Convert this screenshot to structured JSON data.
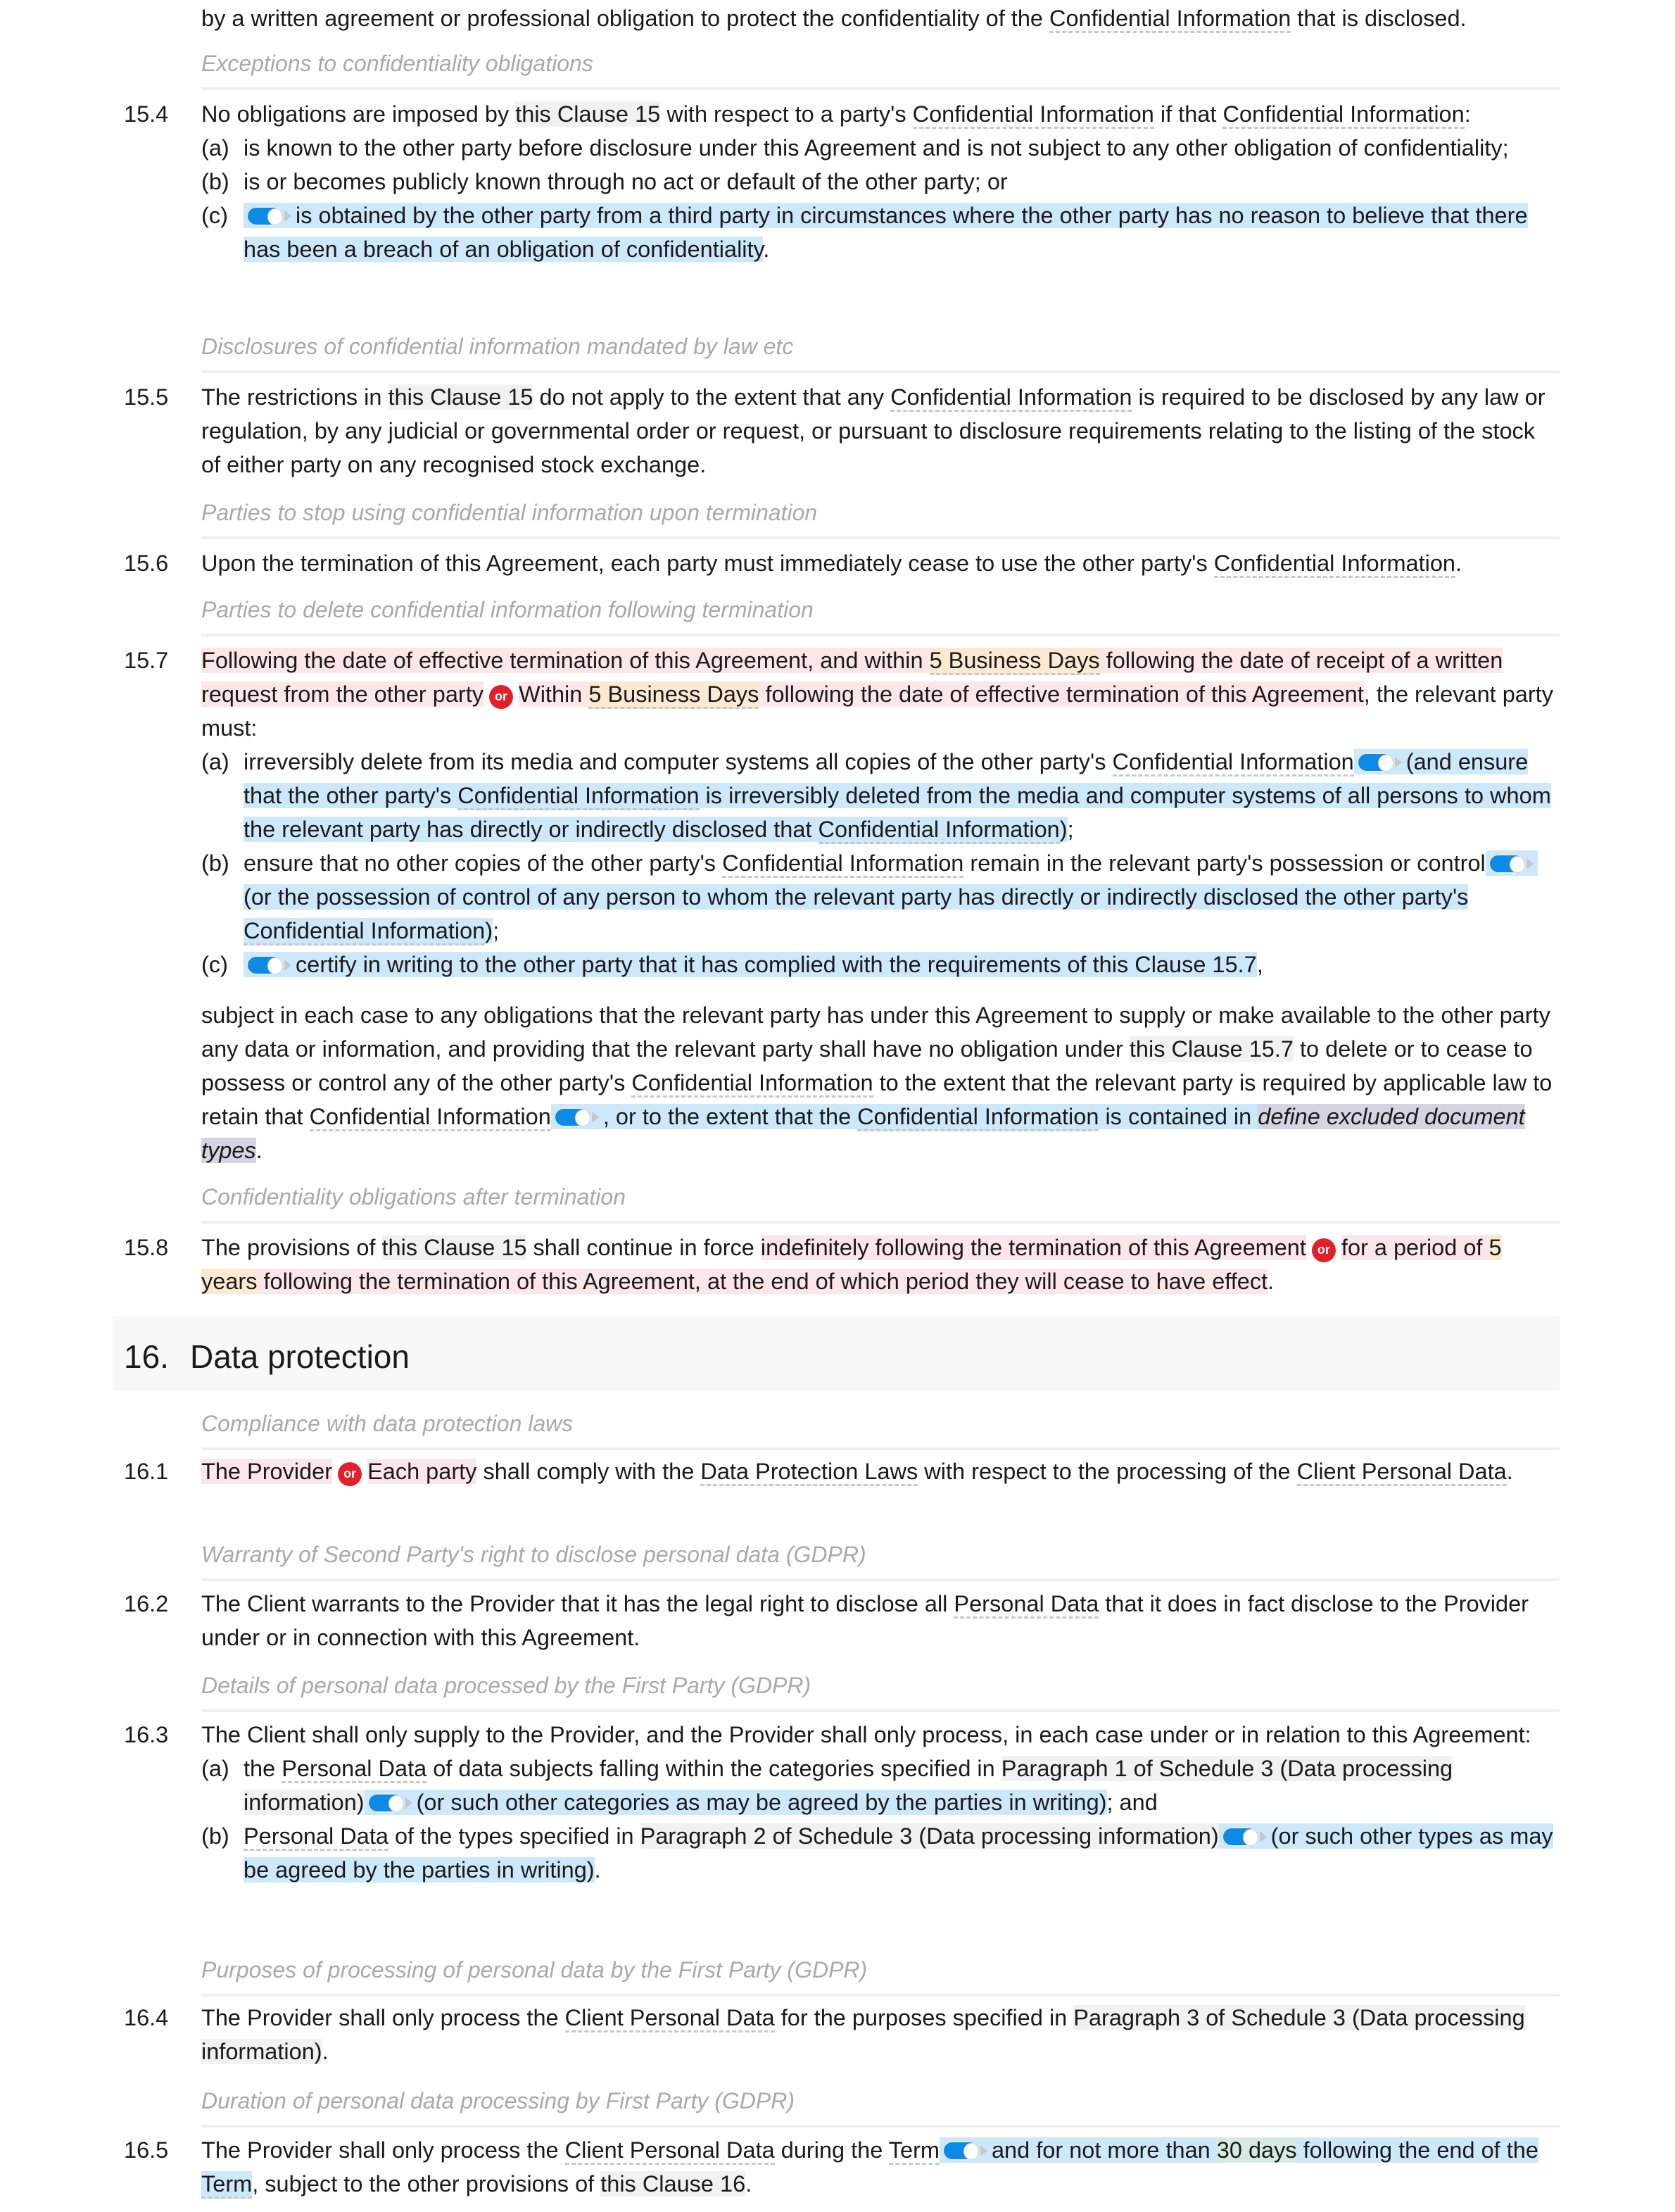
{
  "document": {
    "intro_tail": [
      {
        "t": "by a written agreement or professional obligation to protect the confidentiality of the "
      },
      {
        "t": "Confidential Information",
        "c": "def"
      },
      {
        "t": " that is disclosed."
      }
    ],
    "captions": {
      "c154": "Exceptions to confidentiality obligations",
      "c155": "Disclosures of confidential information mandated by law etc",
      "c156": "Parties to stop using confidential information upon termination",
      "c157": "Parties to delete confidential information following termination",
      "c158": "Confidentiality obligations after termination",
      "c161": "Compliance with data protection laws",
      "c162": "Warranty of Second Party's right to disclose personal data (GDPR)",
      "c163": "Details of personal data processed by the First Party (GDPR)",
      "c164": "Purposes of processing of personal data by the First Party (GDPR)",
      "c165": "Duration of personal data processing by First Party (GDPR)"
    },
    "heading16": {
      "number": "16.",
      "title": "Data protection"
    },
    "clauses": {
      "c154": {
        "number": "15.4",
        "text": [
          {
            "t": "No obligations are imposed by "
          },
          {
            "t": "this Clause 15",
            "c": "ref"
          },
          {
            "t": " with respect to a party's "
          },
          {
            "t": "Confidential Information",
            "c": "def"
          },
          {
            "t": " if that "
          },
          {
            "t": "Confidential Information",
            "c": "def"
          },
          {
            "t": ":"
          }
        ],
        "items": [
          {
            "label": "(a)",
            "text": [
              {
                "t": "is known to the other party before disclosure under this Agreement and is not subject to any other obligation of confidentiality;"
              }
            ]
          },
          {
            "label": "(b)",
            "text": [
              {
                "t": "is or becomes publicly known through no act or default of the other party; or"
              }
            ]
          },
          {
            "label": "(c)",
            "text": [
              {
                "toggle": true,
                "c": "blue"
              },
              {
                "t": "is obtained by the other party from a third party in circumstances where the other party has no reason to believe that there has been a breach of an obligation of confidentiality",
                "c": "blue"
              },
              {
                "t": "."
              }
            ]
          }
        ]
      },
      "c155": {
        "number": "15.5",
        "text": [
          {
            "t": "The restrictions in "
          },
          {
            "t": "this Clause 15",
            "c": "ref"
          },
          {
            "t": " do not apply to the extent that any "
          },
          {
            "t": "Confidential Information",
            "c": "def"
          },
          {
            "t": " is required to be disclosed by any law or regulation, by any judicial or governmental order or request, or pursuant to disclosure requirements relating to the listing of the stock of either party on any recognised stock exchange."
          }
        ]
      },
      "c156": {
        "number": "15.6",
        "text": [
          {
            "t": "Upon the termination of this Agreement, each party must immediately cease to use the other party's "
          },
          {
            "t": "Confidential Information",
            "c": "def"
          },
          {
            "t": "."
          }
        ]
      },
      "c157": {
        "number": "15.7",
        "text": [
          {
            "t": "Following the date of effective termination of this Agreement, and within ",
            "c": "opt"
          },
          {
            "t": "5 Business Days",
            "c": "var def"
          },
          {
            "t": " following the date of receipt of a written request from the other party",
            "c": "opt"
          },
          {
            "or": "or"
          },
          {
            "t": "Within ",
            "c": "opt"
          },
          {
            "t": "5 Business Days",
            "c": "var def"
          },
          {
            "t": " following the date of effective termination of this Agreement",
            "c": "opt"
          },
          {
            "t": ", the relevant party must:"
          }
        ],
        "items": [
          {
            "label": "(a)",
            "text": [
              {
                "t": "irreversibly delete from its media and computer systems all copies of the other party's "
              },
              {
                "t": "Confidential Information",
                "c": "def"
              },
              {
                "toggle": true,
                "c": "blue"
              },
              {
                "t": "(and ensure that the other party's ",
                "c": "blue"
              },
              {
                "t": "Confidential Information",
                "c": "blue def"
              },
              {
                "t": " is irreversibly deleted from the media and computer systems of all persons to whom the relevant party has directly or indirectly disclosed that ",
                "c": "blue"
              },
              {
                "t": "Confidential Information",
                "c": "blue def"
              },
              {
                "t": ")",
                "c": "blue"
              },
              {
                "t": ";"
              }
            ]
          },
          {
            "label": "(b)",
            "text": [
              {
                "t": "ensure that no other copies of the other party's "
              },
              {
                "t": "Confidential Information",
                "c": "def"
              },
              {
                "t": " remain in the relevant party's possession or control"
              },
              {
                "toggle": true,
                "c": "blue"
              },
              {
                "t": "(or the possession of control of any person to whom the relevant party has directly or indirectly disclosed the other party's ",
                "c": "blue"
              },
              {
                "t": "Confidential Information",
                "c": "blue def"
              },
              {
                "t": ")",
                "c": "blue"
              },
              {
                "t": ";"
              }
            ]
          },
          {
            "label": "(c)",
            "text": [
              {
                "toggle": true,
                "c": "blue"
              },
              {
                "t": "certify in writing to the other party that it has complied with the requirements of ",
                "c": "blue"
              },
              {
                "t": "this Clause 15.7",
                "c": "blue ref"
              },
              {
                "t": ","
              }
            ]
          }
        ],
        "tail": [
          {
            "t": "subject in each case to any obligations that the relevant party has under this Agreement to supply or make available to the other party any data or information, and providing that the relevant party shall have no obligation under "
          },
          {
            "t": "this Clause 15.7",
            "c": "ref"
          },
          {
            "t": " to delete or to cease to possess or control any of the other party's "
          },
          {
            "t": "Confidential Information",
            "c": "def"
          },
          {
            "t": " to the extent that the relevant party is required by applicable law to retain that "
          },
          {
            "t": "Confidential Information",
            "c": "def"
          },
          {
            "toggle": true,
            "c": "blue"
          },
          {
            "t": ", or to the extent that the ",
            "c": "blue"
          },
          {
            "t": "Confidential Information",
            "c": "blue def"
          },
          {
            "t": " is contained in ",
            "c": "blue"
          },
          {
            "t": "define excluded document types",
            "c": "ph"
          },
          {
            "t": "."
          }
        ]
      },
      "c158": {
        "number": "15.8",
        "text": [
          {
            "t": "The provisions of "
          },
          {
            "t": "this Clause 15",
            "c": "ref"
          },
          {
            "t": " shall continue in force "
          },
          {
            "t": "indefinitely following the termination of this Agreement",
            "c": "opt"
          },
          {
            "or": "or"
          },
          {
            "t": "for a period of ",
            "c": "opt"
          },
          {
            "t": "5 years",
            "c": "var"
          },
          {
            "t": " following the termination of this Agreement, at the end of which period they will cease to have effect",
            "c": "opt"
          },
          {
            "t": "."
          }
        ]
      },
      "c161": {
        "number": "16.1",
        "text": [
          {
            "t": "The Provider",
            "c": "opt"
          },
          {
            "or": "or"
          },
          {
            "t": "Each party",
            "c": "opt"
          },
          {
            "t": " shall comply with the "
          },
          {
            "t": "Data Protection Laws",
            "c": "def"
          },
          {
            "t": " with respect to the processing of the "
          },
          {
            "t": "Client Personal Data",
            "c": "def"
          },
          {
            "t": "."
          }
        ]
      },
      "c162": {
        "number": "16.2",
        "text": [
          {
            "t": "The Client warrants to the Provider that it has the legal right to disclose all "
          },
          {
            "t": "Personal Data",
            "c": "def"
          },
          {
            "t": " that it does in fact disclose to the Provider under or in connection with this Agreement."
          }
        ]
      },
      "c163": {
        "number": "16.3",
        "text": [
          {
            "t": "The Client shall only supply to the Provider, and the Provider shall only process, in each case under or in relation to this Agreement:"
          }
        ],
        "items": [
          {
            "label": "(a)",
            "text": [
              {
                "t": "the "
              },
              {
                "t": "Personal Data",
                "c": "def"
              },
              {
                "t": " of data subjects falling within the categories specified in "
              },
              {
                "t": "Paragraph 1 of Schedule 3 (Data processing information)",
                "c": "ref"
              },
              {
                "toggle": true,
                "c": "blue"
              },
              {
                "t": "(or such other categories as may be agreed by the parties in writing)",
                "c": "blue"
              },
              {
                "t": "; and"
              }
            ]
          },
          {
            "label": "(b)",
            "text": [
              {
                "t": "Personal Data",
                "c": "def"
              },
              {
                "t": " of the types specified in "
              },
              {
                "t": "Paragraph 2 of Schedule 3 (Data processing information)",
                "c": "ref"
              },
              {
                "toggle": true,
                "c": "blue"
              },
              {
                "t": "(or such other types as may be agreed by the parties in writing)",
                "c": "blue"
              },
              {
                "t": "."
              }
            ]
          }
        ]
      },
      "c164": {
        "number": "16.4",
        "text": [
          {
            "t": "The Provider shall only process the "
          },
          {
            "t": "Client Personal Data",
            "c": "def"
          },
          {
            "t": " for the purposes specified in "
          },
          {
            "t": "Paragraph 3 of Schedule 3 (Data processing information)",
            "c": "ref"
          },
          {
            "t": "."
          }
        ]
      },
      "c165": {
        "number": "16.5",
        "text": [
          {
            "t": "The Provider shall only process the "
          },
          {
            "t": "Client Personal Data",
            "c": "def"
          },
          {
            "t": " during the "
          },
          {
            "t": "Term",
            "c": "def"
          },
          {
            "toggle": true,
            "c": "blue"
          },
          {
            "t": "and for not more than ",
            "c": "blue"
          },
          {
            "t": "30 days",
            "c": "green"
          },
          {
            "t": " following the end of the ",
            "c": "blue"
          },
          {
            "t": "Term",
            "c": "blue def"
          },
          {
            "t": ", subject to the other provisions of "
          },
          {
            "t": "this Clause 16",
            "c": "ref"
          },
          {
            "t": "."
          }
        ]
      }
    }
  }
}
